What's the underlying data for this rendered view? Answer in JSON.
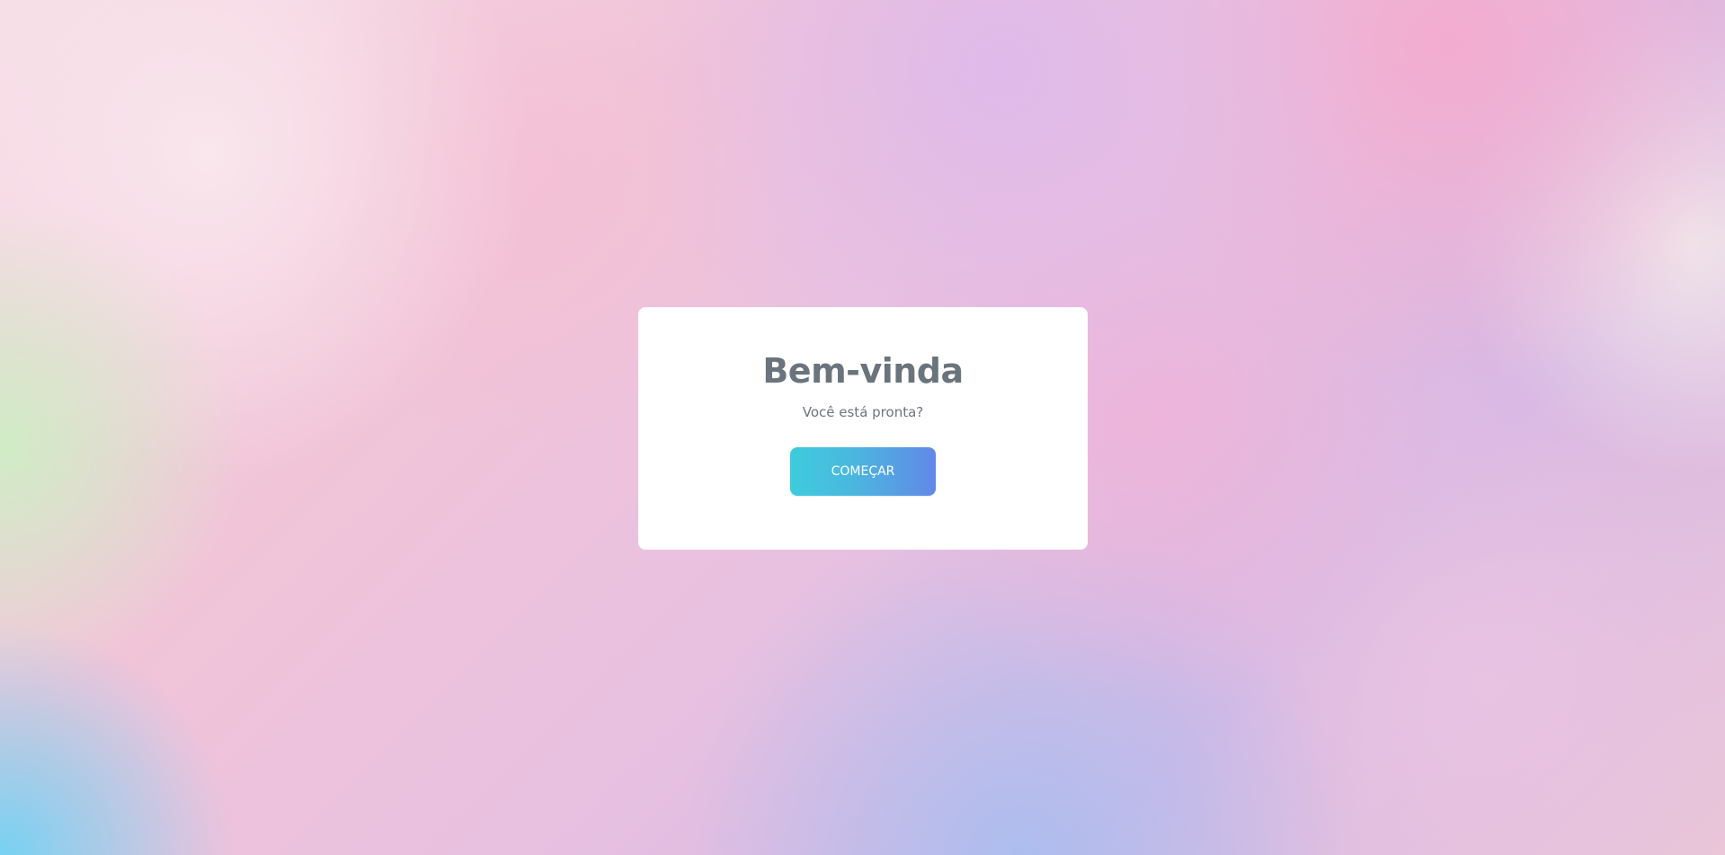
{
  "welcome_modal": {
    "title": "Bem-vinda",
    "subtitle": "Você está pronta?",
    "start_button_label": "COMEÇAR"
  },
  "colors": {
    "card_background": "#ffffff",
    "title_text": "#6a747d",
    "button_gradient_start": "#3ecbdc",
    "button_gradient_end": "#6288e8",
    "button_text": "#ffffff"
  }
}
